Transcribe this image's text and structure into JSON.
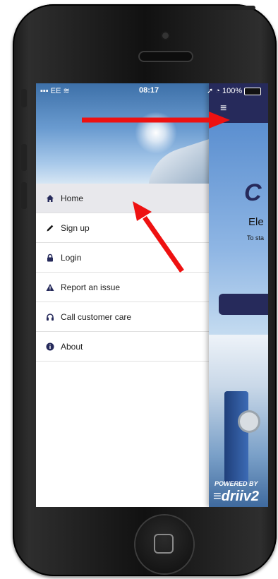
{
  "status_bar": {
    "carrier": "EE",
    "time": "08:17",
    "battery": "100%"
  },
  "menu": {
    "items": [
      {
        "label": "Home",
        "icon": "home-icon"
      },
      {
        "label": "Sign up",
        "icon": "pencil-icon"
      },
      {
        "label": "Login",
        "icon": "lock-icon"
      },
      {
        "label": "Report an issue",
        "icon": "warning-icon"
      },
      {
        "label": "Call customer care",
        "icon": "headset-icon"
      },
      {
        "label": "About",
        "icon": "info-icon"
      }
    ],
    "active_index": 0
  },
  "main": {
    "hamburger": "≡",
    "hero_logo": "C",
    "hero_title": "Ele",
    "hero_subtitle": "To sta",
    "powered_by": "POWERED BY",
    "brand": "≡driiv2"
  },
  "colors": {
    "navbar": "#262a5b",
    "annotation": "#ee1111"
  }
}
